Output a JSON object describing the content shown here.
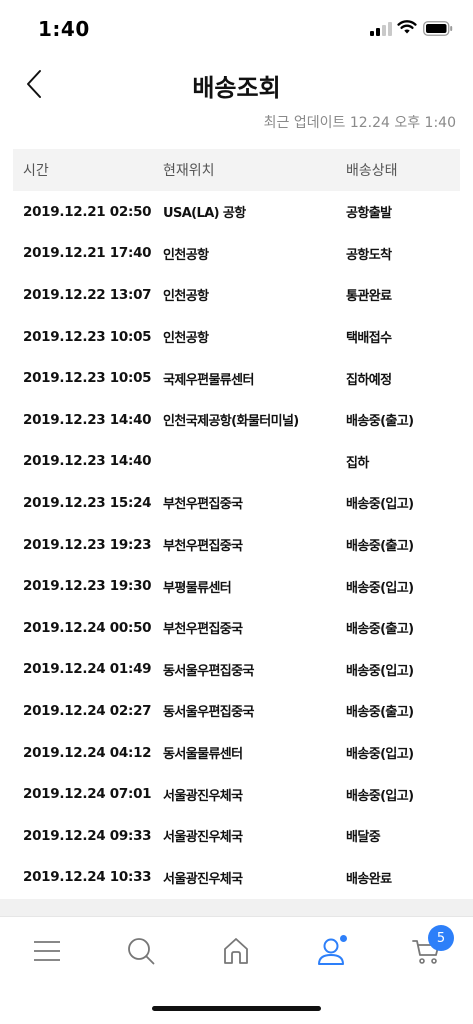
{
  "status_bar": {
    "time": "1:40"
  },
  "header": {
    "title": "배송조회"
  },
  "update": {
    "label": "최근 업데이트",
    "value": "12.24 오후 1:40"
  },
  "table": {
    "headers": {
      "time": "시간",
      "location": "현재위치",
      "status": "배송상태"
    },
    "rows": [
      {
        "time": "2019.12.21 02:50",
        "location": "USA(LA) 공항",
        "status": "공항출발"
      },
      {
        "time": "2019.12.21 17:40",
        "location": "인천공항",
        "status": "공항도착"
      },
      {
        "time": "2019.12.22 13:07",
        "location": "인천공항",
        "status": "통관완료"
      },
      {
        "time": "2019.12.23 10:05",
        "location": "인천공항",
        "status": "택배접수"
      },
      {
        "time": "2019.12.23 10:05",
        "location": "국제우편물류센터",
        "status": "집하예정"
      },
      {
        "time": "2019.12.23 14:40",
        "location": "인천국제공항(화물터미널)",
        "status": "배송중(출고)"
      },
      {
        "time": "2019.12.23 14:40",
        "location": "",
        "status": "집하"
      },
      {
        "time": "2019.12.23 15:24",
        "location": "부천우편집중국",
        "status": "배송중(입고)"
      },
      {
        "time": "2019.12.23 19:23",
        "location": "부천우편집중국",
        "status": "배송중(출고)"
      },
      {
        "time": "2019.12.23 19:30",
        "location": "부평물류센터",
        "status": "배송중(입고)"
      },
      {
        "time": "2019.12.24 00:50",
        "location": "부천우편집중국",
        "status": "배송중(출고)"
      },
      {
        "time": "2019.12.24 01:49",
        "location": "동서울우편집중국",
        "status": "배송중(입고)"
      },
      {
        "time": "2019.12.24 02:27",
        "location": "동서울우편집중국",
        "status": "배송중(출고)"
      },
      {
        "time": "2019.12.24 04:12",
        "location": "동서울물류센터",
        "status": "배송중(입고)"
      },
      {
        "time": "2019.12.24 07:01",
        "location": "서울광진우체국",
        "status": "배송중(입고)"
      },
      {
        "time": "2019.12.24 09:33",
        "location": "서울광진우체국",
        "status": "배달중"
      },
      {
        "time": "2019.12.24 10:33",
        "location": "서울광진우체국",
        "status": "배송완료"
      }
    ]
  },
  "tab_bar": {
    "items": [
      {
        "icon": "menu-icon"
      },
      {
        "icon": "search-icon"
      },
      {
        "icon": "home-icon"
      },
      {
        "icon": "user-icon",
        "active": true
      },
      {
        "icon": "cart-icon"
      }
    ],
    "cart_badge": "5",
    "accent": "#2d7ff9"
  }
}
